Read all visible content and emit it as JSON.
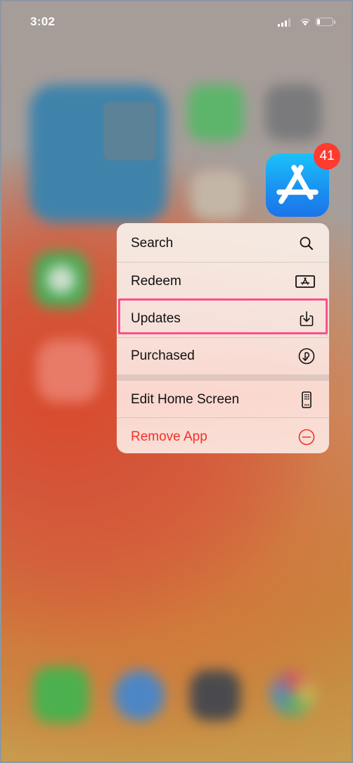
{
  "status_bar": {
    "time": "3:02",
    "signal_bars_filled": 3,
    "signal_bars_total": 4,
    "wifi": "wifi-icon",
    "battery_level": 0.2
  },
  "app_icon": {
    "name": "App Store",
    "icon": "app-store-icon",
    "badge_count": "41",
    "badge_color": "#ff3b30"
  },
  "context_menu": {
    "items": [
      {
        "label": "Search",
        "icon": "magnifying-glass-icon",
        "destructive": false
      },
      {
        "label": "Redeem",
        "icon": "gift-card-icon",
        "destructive": false
      },
      {
        "label": "Updates",
        "icon": "download-tray-icon",
        "destructive": false,
        "highlighted": true
      },
      {
        "label": "Purchased",
        "icon": "purchased-circle-icon",
        "destructive": false
      },
      {
        "label": "Edit Home Screen",
        "icon": "phone-apps-icon",
        "destructive": false
      },
      {
        "label": "Remove App",
        "icon": "minus-circle-icon",
        "destructive": true
      }
    ],
    "destructive_color": "#f2312a",
    "highlight_color": "#f9508a"
  }
}
